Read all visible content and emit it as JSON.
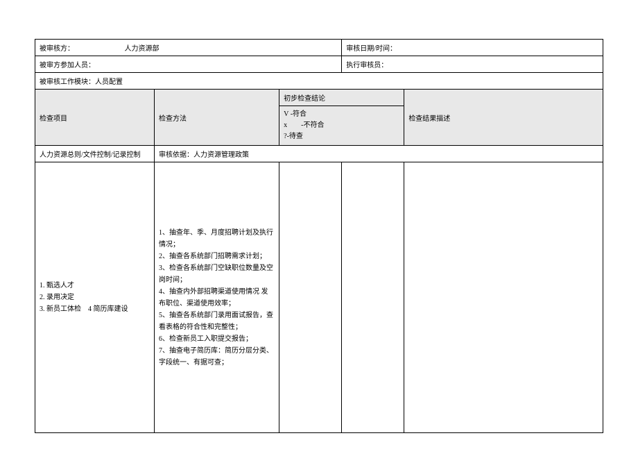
{
  "header": {
    "audited_party_label": "被审核方：",
    "audited_party_value": "人力资源部",
    "audit_date_label": "审核日期/时间：",
    "participants_label": "被审方参加人员：",
    "auditor_label": "执行审核员：",
    "module_label": "被审核工作模块：人员配置"
  },
  "columns": {
    "check_item": "检查项目",
    "check_method": "检查方法",
    "prelim_conclusion": "初步检查结论",
    "legend_v": "V -符合",
    "legend_x": "x　　-不符合",
    "legend_q": "?-待查",
    "result_desc": "检查结果描述"
  },
  "basis": {
    "left": "人力资源总则/文件控制/记录控制",
    "right": "审核依据：人力资源管理政策"
  },
  "content": {
    "items": "1. 甄选人才\n2. 录用决定\n3. 新员工体检　4 简历库建设",
    "methods": "1、抽查年、季、月度招聘计划及执行 情况；\n2、抽查各系统部门招聘需求计划；\n3、检查各系统部门空缺职位数量及空 岗时间；\n4、抽查内外部招聘渠道使用情况 发　布职位、渠道使用效率；\n5、抽查各系统部门录用面试报告，查 看表格的符合性和完整性；\n6、检查新员工入职提交报告；\n7、抽查电子简历库：简历分层分类、　字段统一、有据可查；"
  }
}
